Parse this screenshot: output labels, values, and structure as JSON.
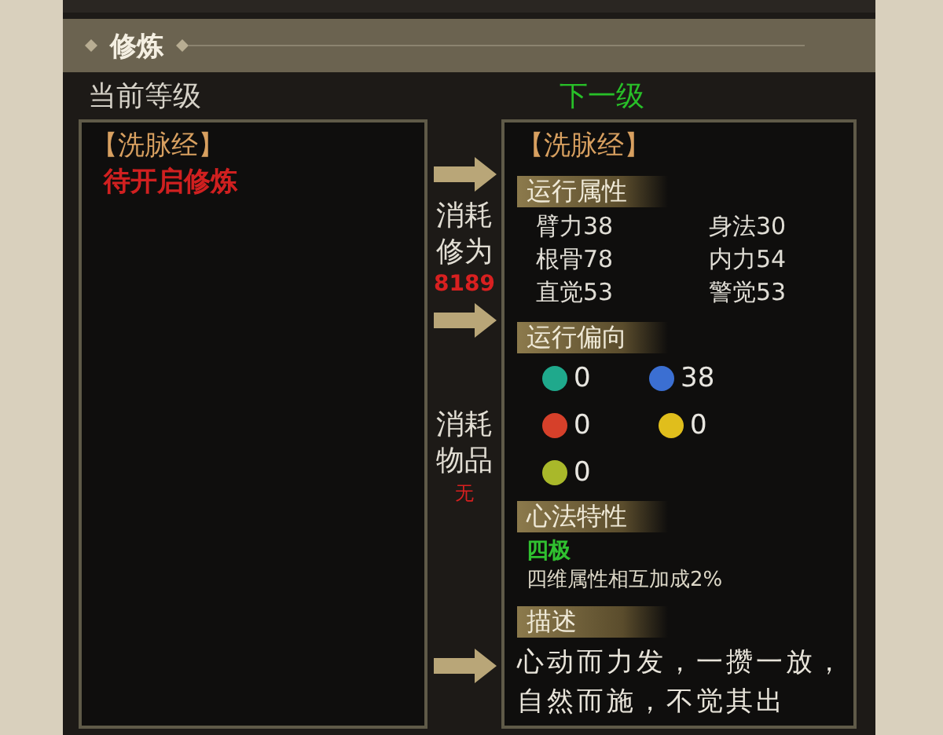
{
  "panel": {
    "title": "修炼"
  },
  "current": {
    "heading": "当前等级",
    "skill": "【洗脉经】",
    "status": "待开启修炼"
  },
  "costs": [
    {
      "label": "消耗修为",
      "value": "8189"
    },
    {
      "label": "消耗物品",
      "value": "无"
    }
  ],
  "next": {
    "heading": "下一级",
    "skill": "【洗脉经】",
    "attributes_heading": "运行属性",
    "attributes": [
      "臂力38",
      "身法30",
      "根骨78",
      "内力54",
      "直觉53",
      "警觉53"
    ],
    "orientation_heading": "运行偏向",
    "orientation": [
      {
        "color": "#1fa98c",
        "value": "0"
      },
      {
        "color": "#3b6fd2",
        "value": "38"
      },
      {
        "color": "#d6402a",
        "value": "0"
      },
      {
        "color": "#e0be1c",
        "value": "0"
      },
      {
        "color": "#a9b82a",
        "value": "0"
      }
    ],
    "trait_heading": "心法特性",
    "trait_name": "四极",
    "trait_text": "四维属性相互加成2%",
    "description_heading": "描述",
    "description": "心动而力发，一攒一放，自然而施，不觉其出"
  }
}
